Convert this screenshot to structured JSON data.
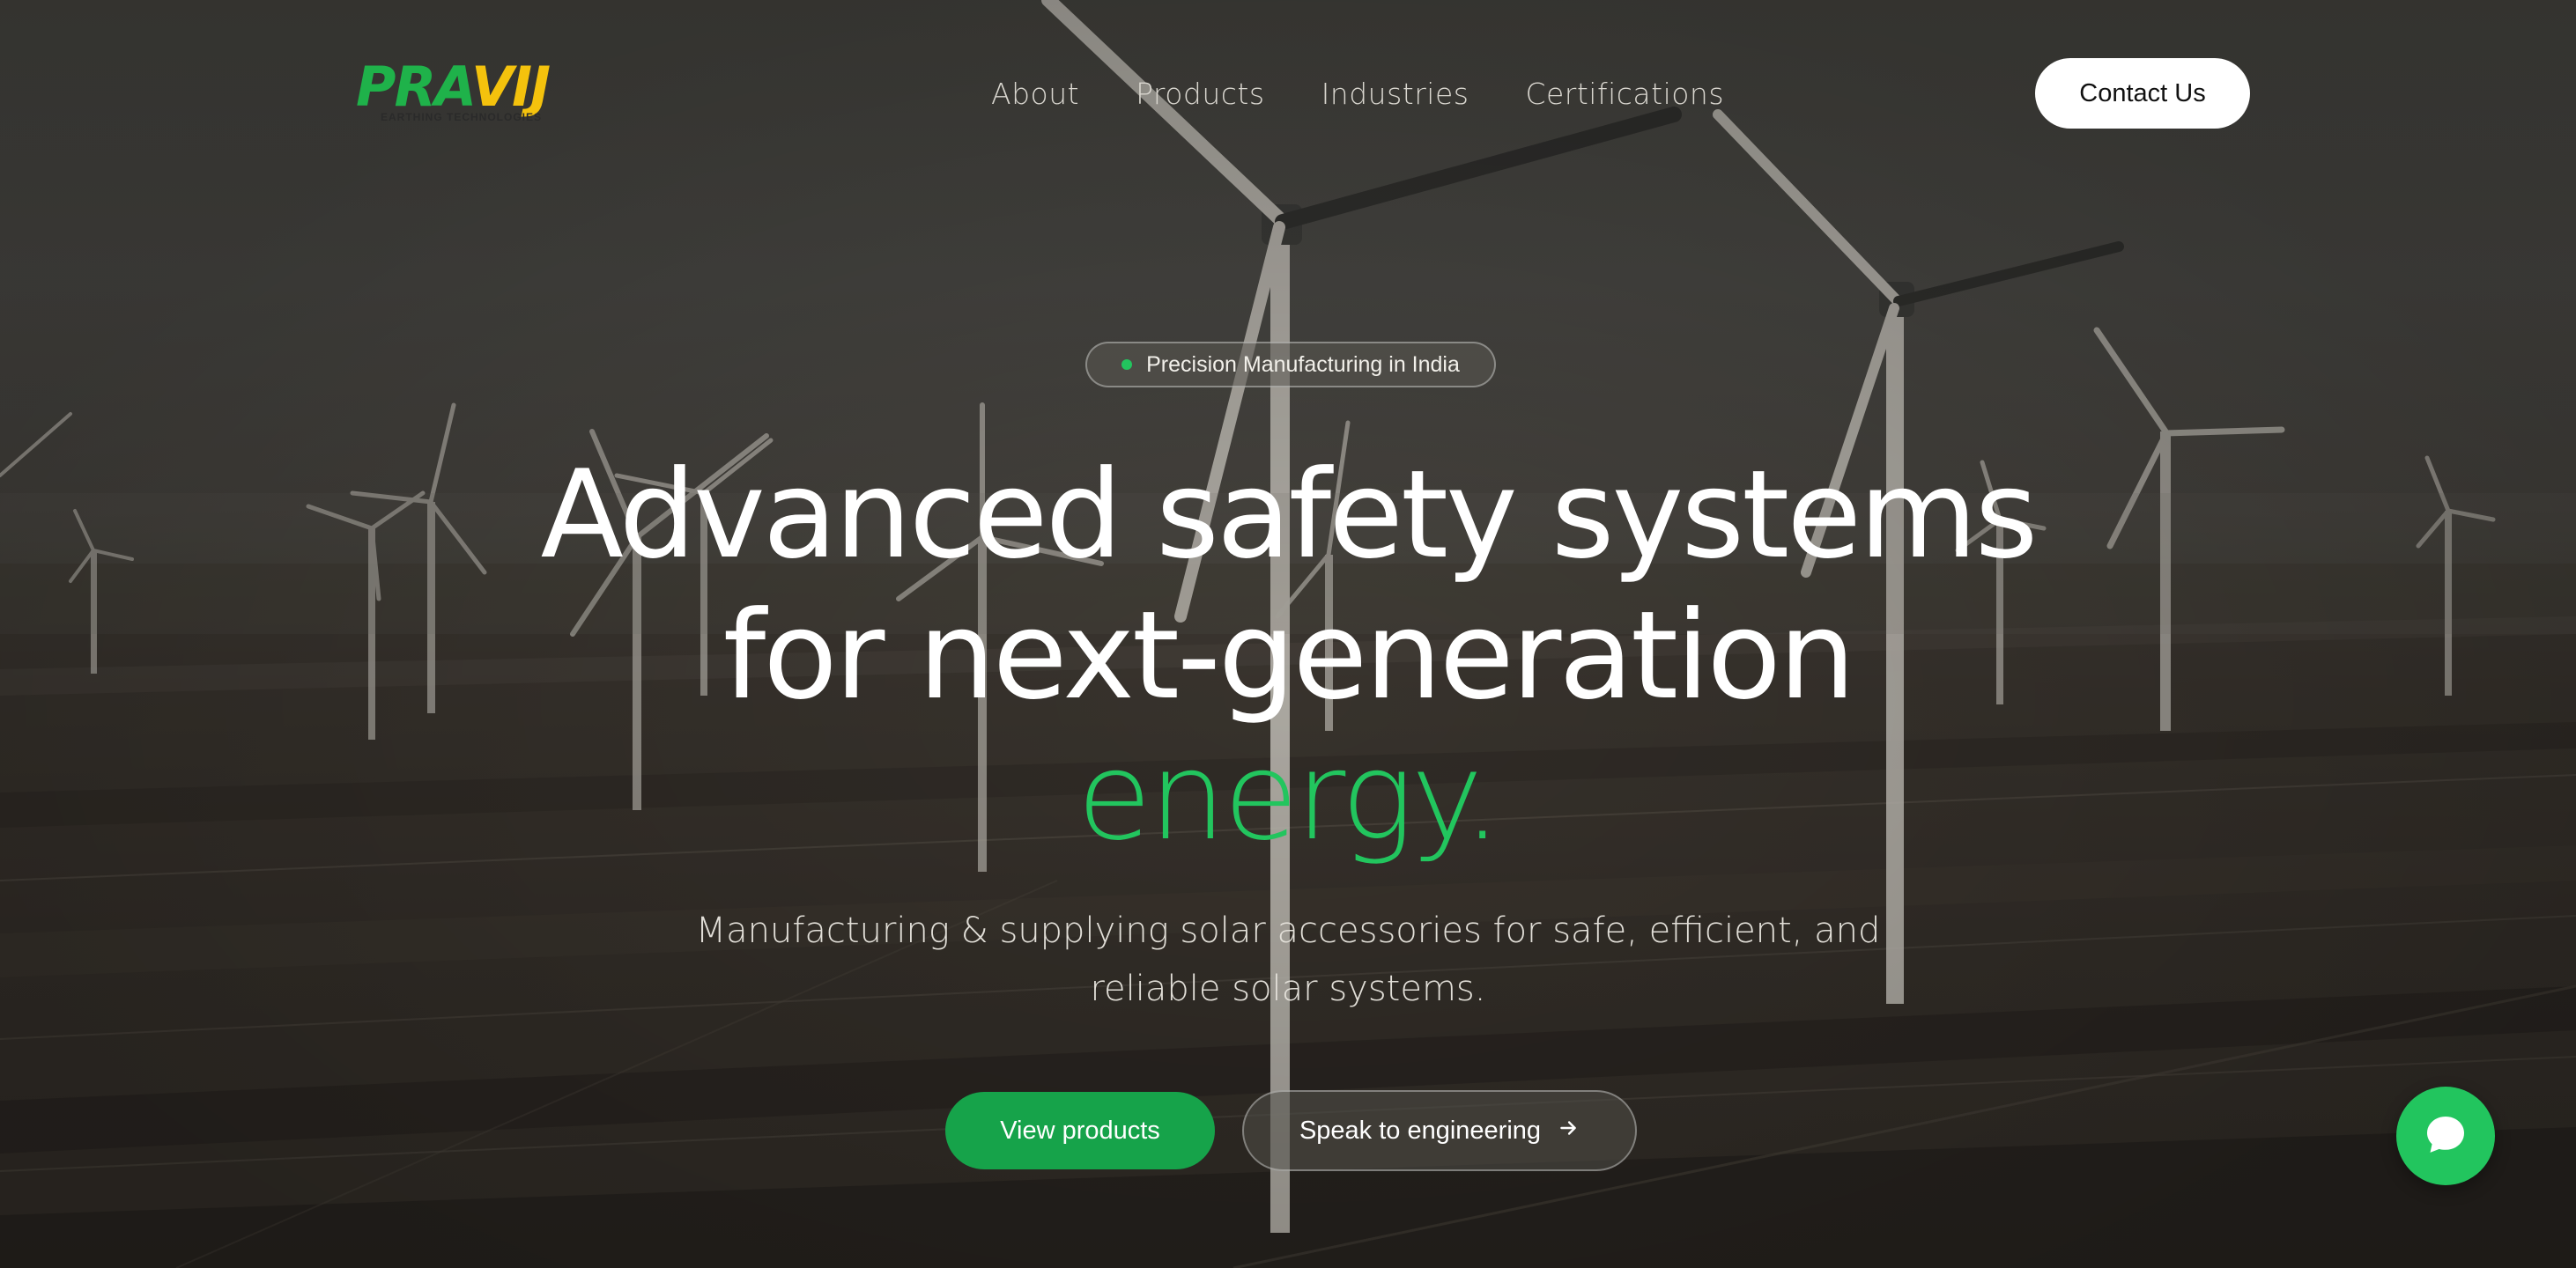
{
  "brand": {
    "logo_part1": "PRA",
    "logo_part2": "VIJ",
    "tagline": "EARTHING TECHNOLOGIES",
    "colors": {
      "green": "#1fb24a",
      "yellow": "#f4c20d"
    }
  },
  "nav": {
    "items": [
      {
        "label": "About"
      },
      {
        "label": "Products"
      },
      {
        "label": "Industries"
      },
      {
        "label": "Certifications"
      }
    ],
    "contact_label": "Contact Us"
  },
  "hero": {
    "badge": "Precision Manufacturing in India",
    "headline_main": "Advanced safety systems for next-generation",
    "headline_accent": "energy.",
    "subtext": "Manufacturing & supplying solar accessories for safe, efficient, and reliable solar systems.",
    "primary_button": "View products",
    "secondary_button": "Speak to engineering",
    "secondary_icon": "arrow-right-icon"
  },
  "chat": {
    "icon": "chat-bubble-icon"
  },
  "colors": {
    "accent": "#22c55e",
    "button_green": "#16a34a"
  }
}
